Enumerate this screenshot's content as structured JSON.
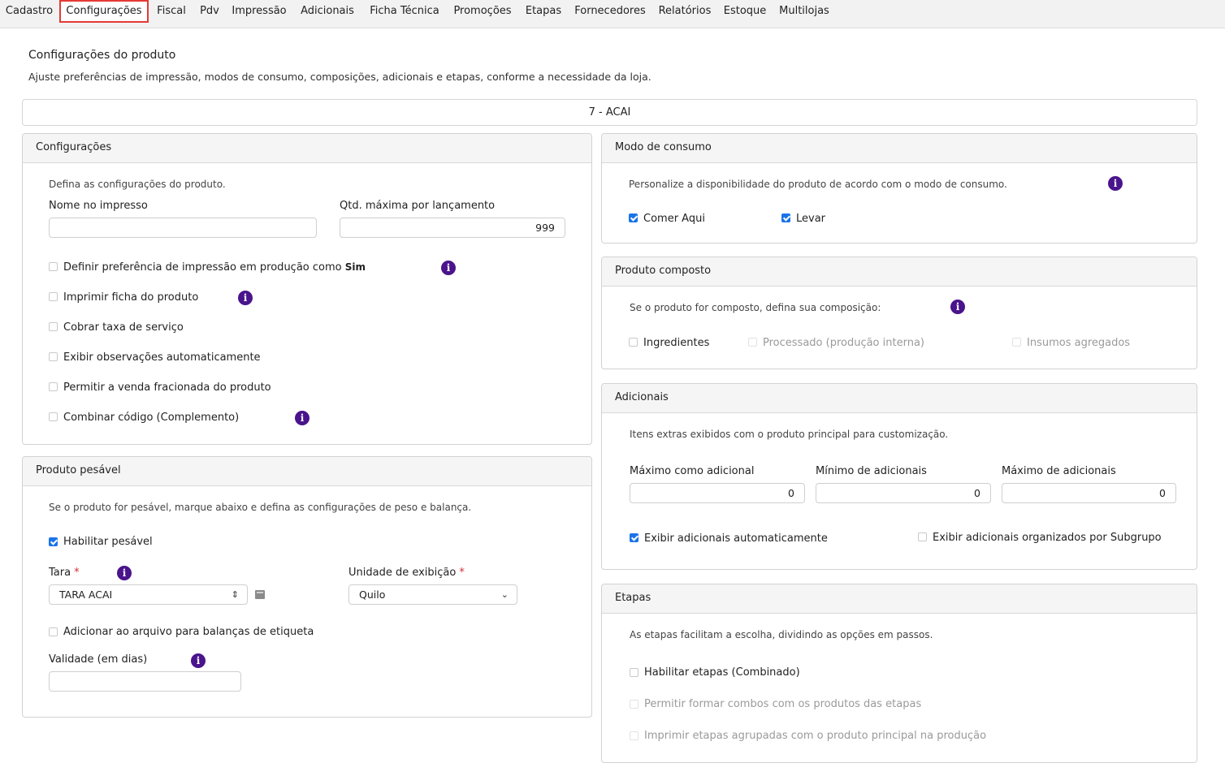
{
  "tabs": [
    "Cadastro",
    "Configurações",
    "Fiscal",
    "Pdv",
    "Impressão",
    "Adicionais",
    "Ficha Técnica",
    "Promoções",
    "Etapas",
    "Fornecedores",
    "Relatórios",
    "Estoque",
    "Multilojas"
  ],
  "active_tab": "Configurações",
  "page": {
    "title": "Configurações do produto",
    "description": "Ajuste preferências de impressão, modos de consumo, composições, adicionais e etapas, conforme a necessidade da loja.",
    "product": "7 - ACAI"
  },
  "configuracoes": {
    "header": "Configurações",
    "description": "Defina as configurações do produto.",
    "nome_label": "Nome no impresso",
    "nome_value": "",
    "qtd_label": "Qtd. máxima por lançamento",
    "qtd_value": "999",
    "options": [
      {
        "label": "Definir preferência de impressão em produção como",
        "suffix": "Sim",
        "checked": false
      },
      {
        "label": "Imprimir ficha do produto",
        "checked": false
      },
      {
        "label": "Cobrar taxa de serviço",
        "checked": false
      },
      {
        "label": "Exibir observações automaticamente",
        "checked": false
      },
      {
        "label": "Permitir a venda fracionada do produto",
        "checked": false
      },
      {
        "label": "Combinar código (Complemento)",
        "checked": false
      }
    ]
  },
  "pesavel": {
    "header": "Produto pesável",
    "description": "Se o produto for pesável, marque abaixo e defina as configurações de peso e balança.",
    "habilitar_label": "Habilitar pesável",
    "habilitar_checked": true,
    "tara_label": "Tara",
    "tara_value": "TARA ACAI",
    "unidade_label": "Unidade de exibição",
    "unidade_value": "Quilo",
    "required_mark": "*",
    "arquivo_label": "Adicionar ao arquivo para balanças de etiqueta",
    "arquivo_checked": false,
    "validade_label": "Validade (em dias)",
    "validade_value": ""
  },
  "consumo": {
    "header": "Modo de consumo",
    "description": "Personalize a disponibilidade do produto de acordo com o modo de consumo.",
    "comer_aqui_label": "Comer Aqui",
    "comer_aqui_checked": true,
    "levar_label": "Levar",
    "levar_checked": true
  },
  "composto": {
    "header": "Produto composto",
    "description": "Se o produto for composto, defina sua composição:",
    "ingredientes_label": "Ingredientes",
    "processado_label": "Processado (produção interna)",
    "insumos_label": "Insumos agregados"
  },
  "adicionais": {
    "header": "Adicionais",
    "description": "Itens extras exibidos com o produto principal para customização.",
    "max_como_label": "Máximo como adicional",
    "max_como_value": "0",
    "min_label": "Mínimo de adicionais",
    "min_value": "0",
    "max_label": "Máximo de adicionais",
    "max_value": "0",
    "exibir_auto_label": "Exibir adicionais automaticamente",
    "exibir_auto_checked": true,
    "exibir_subgrupo_label": "Exibir adicionais organizados por Subgrupo",
    "exibir_subgrupo_checked": false
  },
  "etapas": {
    "header": "Etapas",
    "description": "As etapas facilitam a escolha, dividindo as opções em passos.",
    "habilitar_label": "Habilitar etapas (Combinado)",
    "combos_label": "Permitir formar combos com os produtos das etapas",
    "agrupadas_label": "Imprimir etapas agrupadas com o produto principal na produção"
  },
  "info_glyph": "i",
  "colors": {
    "accent": "#1a73e8",
    "info": "#4a148c",
    "active_tab_border": "#e53935",
    "required": "#d32f2f"
  }
}
